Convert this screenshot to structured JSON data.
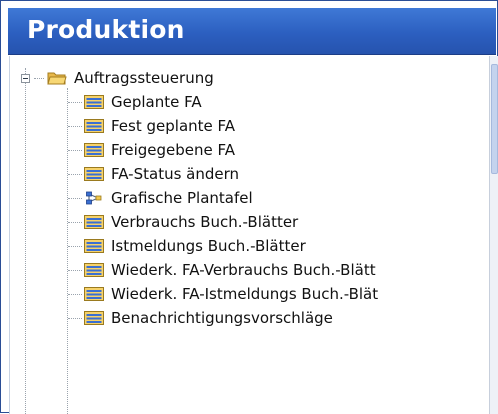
{
  "window": {
    "title": "Produktion"
  },
  "tree": {
    "root": {
      "label": "Auftragssteuerung",
      "expanded": true,
      "icon": "folder-open-icon"
    },
    "items": [
      {
        "label": "Geplante FA",
        "icon": "list-form-icon"
      },
      {
        "label": "Fest geplante FA",
        "icon": "list-form-icon"
      },
      {
        "label": "Freigegebene FA",
        "icon": "list-form-icon"
      },
      {
        "label": "FA-Status ändern",
        "icon": "list-form-icon"
      },
      {
        "label": "Grafische Plantafel",
        "icon": "graph-nodes-icon"
      },
      {
        "label": "Verbrauchs Buch.-Blätter",
        "icon": "list-form-icon"
      },
      {
        "label": "Istmeldungs Buch.-Blätter",
        "icon": "list-form-icon"
      },
      {
        "label": "Wiederk. FA-Verbrauchs Buch.-Blätt",
        "icon": "list-form-icon"
      },
      {
        "label": "Wiederk. FA-Istmeldungs Buch.-Blät",
        "icon": "list-form-icon"
      },
      {
        "label": "Benachrichtigungsvorschläge",
        "icon": "list-form-icon"
      }
    ]
  },
  "colors": {
    "header_bg": "#2c5fc0",
    "header_text": "#ffffff",
    "icon_yellow": "#f2c94c",
    "icon_blue": "#3a6fd2"
  }
}
